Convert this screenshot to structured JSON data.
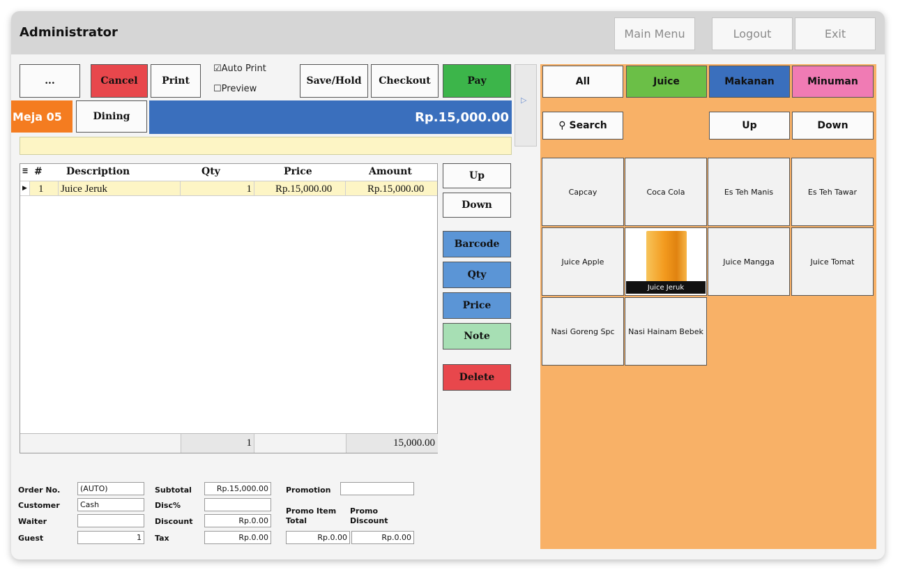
{
  "titlebar": {
    "title": "Administrator",
    "main_menu": "Main Menu",
    "logout": "Logout",
    "exit": "Exit"
  },
  "toolbar": {
    "more": "...",
    "cancel": "Cancel",
    "print": "Print",
    "auto_print": "Auto Print",
    "auto_print_checked": true,
    "preview": "Preview",
    "preview_checked": false,
    "save_hold": "Save/Hold",
    "checkout": "Checkout",
    "pay": "Pay"
  },
  "order_bar": {
    "table": "Meja 05",
    "mode": "Dining",
    "total": "Rp.15,000.00"
  },
  "grid": {
    "columns": [
      "#",
      "Description",
      "Qty",
      "Price",
      "Amount"
    ],
    "rows": [
      {
        "no": "1",
        "description": "Juice Jeruk",
        "qty": "1",
        "price": "Rp.15,000.00",
        "amount": "Rp.15,000.00"
      }
    ],
    "footer_qty": "1",
    "footer_amount": "15,000.00"
  },
  "side_buttons": {
    "up": "Up",
    "down": "Down",
    "barcode": "Barcode",
    "qty": "Qty",
    "price": "Price",
    "note": "Note",
    "delete": "Delete"
  },
  "form": {
    "order_no_label": "Order No.",
    "order_no": "(AUTO)",
    "customer_label": "Customer",
    "customer": "Cash",
    "waiter_label": "Waiter",
    "waiter": "",
    "guest_label": "Guest",
    "guest": "1",
    "subtotal_label": "Subtotal",
    "subtotal": "Rp.15,000.00",
    "disc_pct_label": "Disc%",
    "disc_pct": "",
    "discount_label": "Discount",
    "discount": "Rp.0.00",
    "tax_label": "Tax",
    "tax": "Rp.0.00",
    "promotion_label": "Promotion",
    "promotion": "",
    "promo_item_total_label_1": "Promo Item",
    "promo_item_total_label_2": "Total",
    "promo_item_total": "Rp.0.00",
    "promo_discount_label_1": "Promo",
    "promo_discount_label_2": "Discount",
    "promo_discount": "Rp.0.00"
  },
  "categories": [
    {
      "label": "All",
      "color": "#fbfbfb"
    },
    {
      "label": "Juice",
      "color": "#6bbf47"
    },
    {
      "label": "Makanan",
      "color": "#3a6fbd"
    },
    {
      "label": "Minuman",
      "color": "#f07bb4"
    }
  ],
  "product_nav": {
    "search": "Search",
    "up": "Up",
    "down": "Down"
  },
  "products": [
    "Capcay",
    "Coca Cola",
    "Es Teh Manis",
    "Es Teh Tawar",
    "Juice Apple",
    "Juice Jeruk",
    "Juice Mangga",
    "Juice Tomat",
    "Nasi Goreng Spc",
    "Nasi Hainam Bebek"
  ]
}
